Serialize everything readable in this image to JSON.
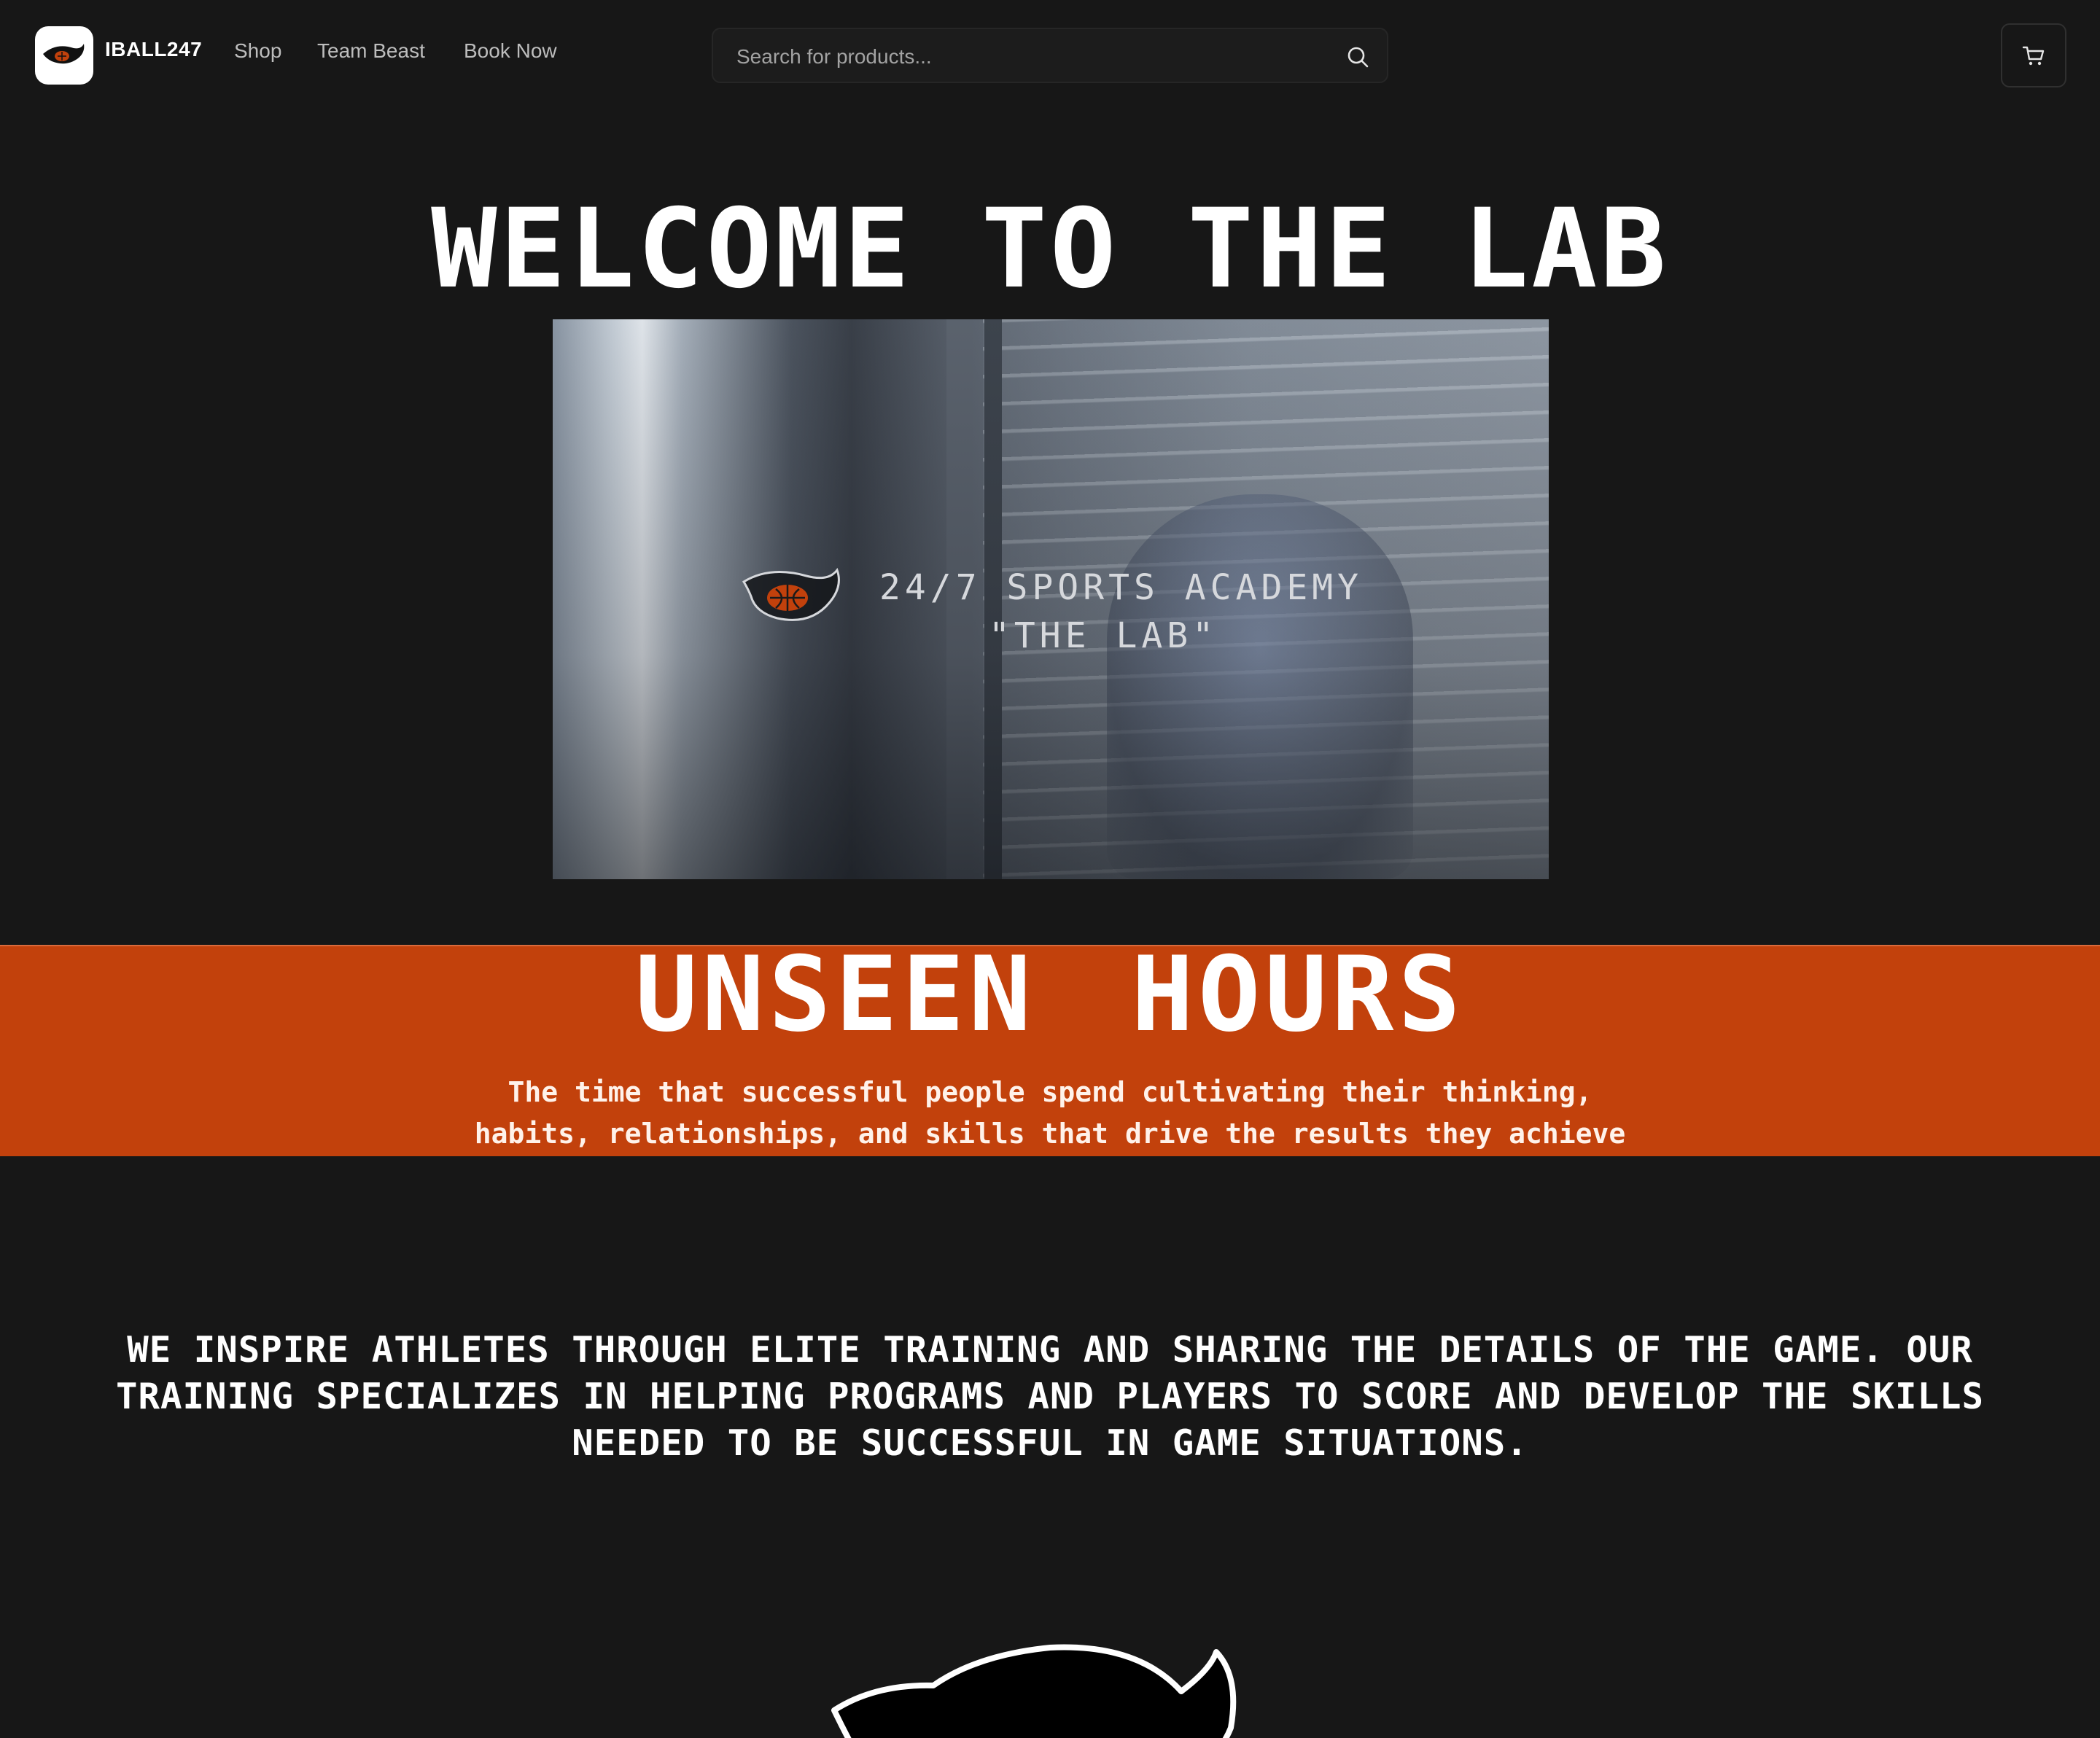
{
  "header": {
    "brand": "IBALL247",
    "nav": [
      "Shop",
      "Team Beast",
      "Book Now"
    ],
    "search_placeholder": "Search for products..."
  },
  "hero": {
    "title": "WELCOME TO THE LAB",
    "video_line1": "24/7 SPORTS ACADEMY",
    "video_line2": "\"THE LAB\""
  },
  "band": {
    "title": "UNSEEN HOURS",
    "subtitle_line1": "The time that successful people spend cultivating their thinking,",
    "subtitle_line2": "habits, relationships, and skills that drive the results they achieve"
  },
  "mission": {
    "text": "We inspire athletes through elite training and sharing the details of the game. Our training specializes in helping programs and players to score and develop the skills needed to be successful in game situations."
  },
  "colors": {
    "background": "#171717",
    "accent": "#c2410c",
    "text": "#ffffff"
  },
  "icons": {
    "logo": "eye-basketball-logo",
    "search": "search-icon",
    "cart": "cart-icon"
  }
}
